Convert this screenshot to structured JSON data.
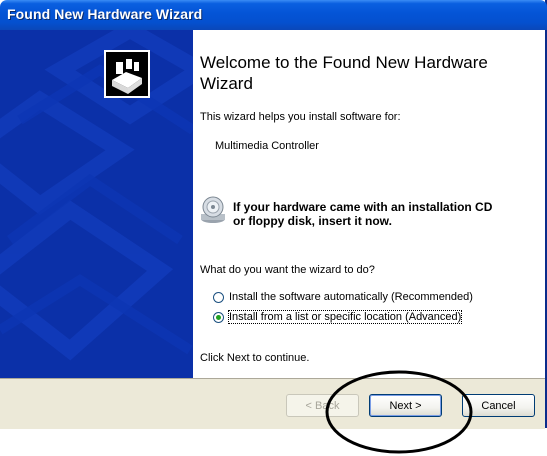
{
  "window": {
    "title": "Found New Hardware Wizard"
  },
  "content": {
    "heading": "Welcome to the Found New Hardware Wizard",
    "intro": "This wizard helps you install software for:",
    "device": "Multimedia Controller",
    "cd_note_line1": "If your hardware came with an installation CD",
    "cd_note_line2": "or floppy disk, insert it now.",
    "question": "What do you want the wizard to do?",
    "options": [
      {
        "label": "Install the software automatically (Recommended)",
        "checked": false
      },
      {
        "label": "Install from a list or specific location (Advanced)",
        "checked": true
      }
    ],
    "footer": "Click Next to continue."
  },
  "buttons": {
    "back": "< Back",
    "next": "Next >",
    "cancel": "Cancel"
  },
  "icons": {
    "wizard": "hardware-wizard-icon",
    "cd": "cd-disk-icon"
  },
  "colors": {
    "titlebar": "#0454d6",
    "sidepanel": "#0b30a8",
    "radio_selected": "#21a121",
    "button_border": "#003c74"
  }
}
